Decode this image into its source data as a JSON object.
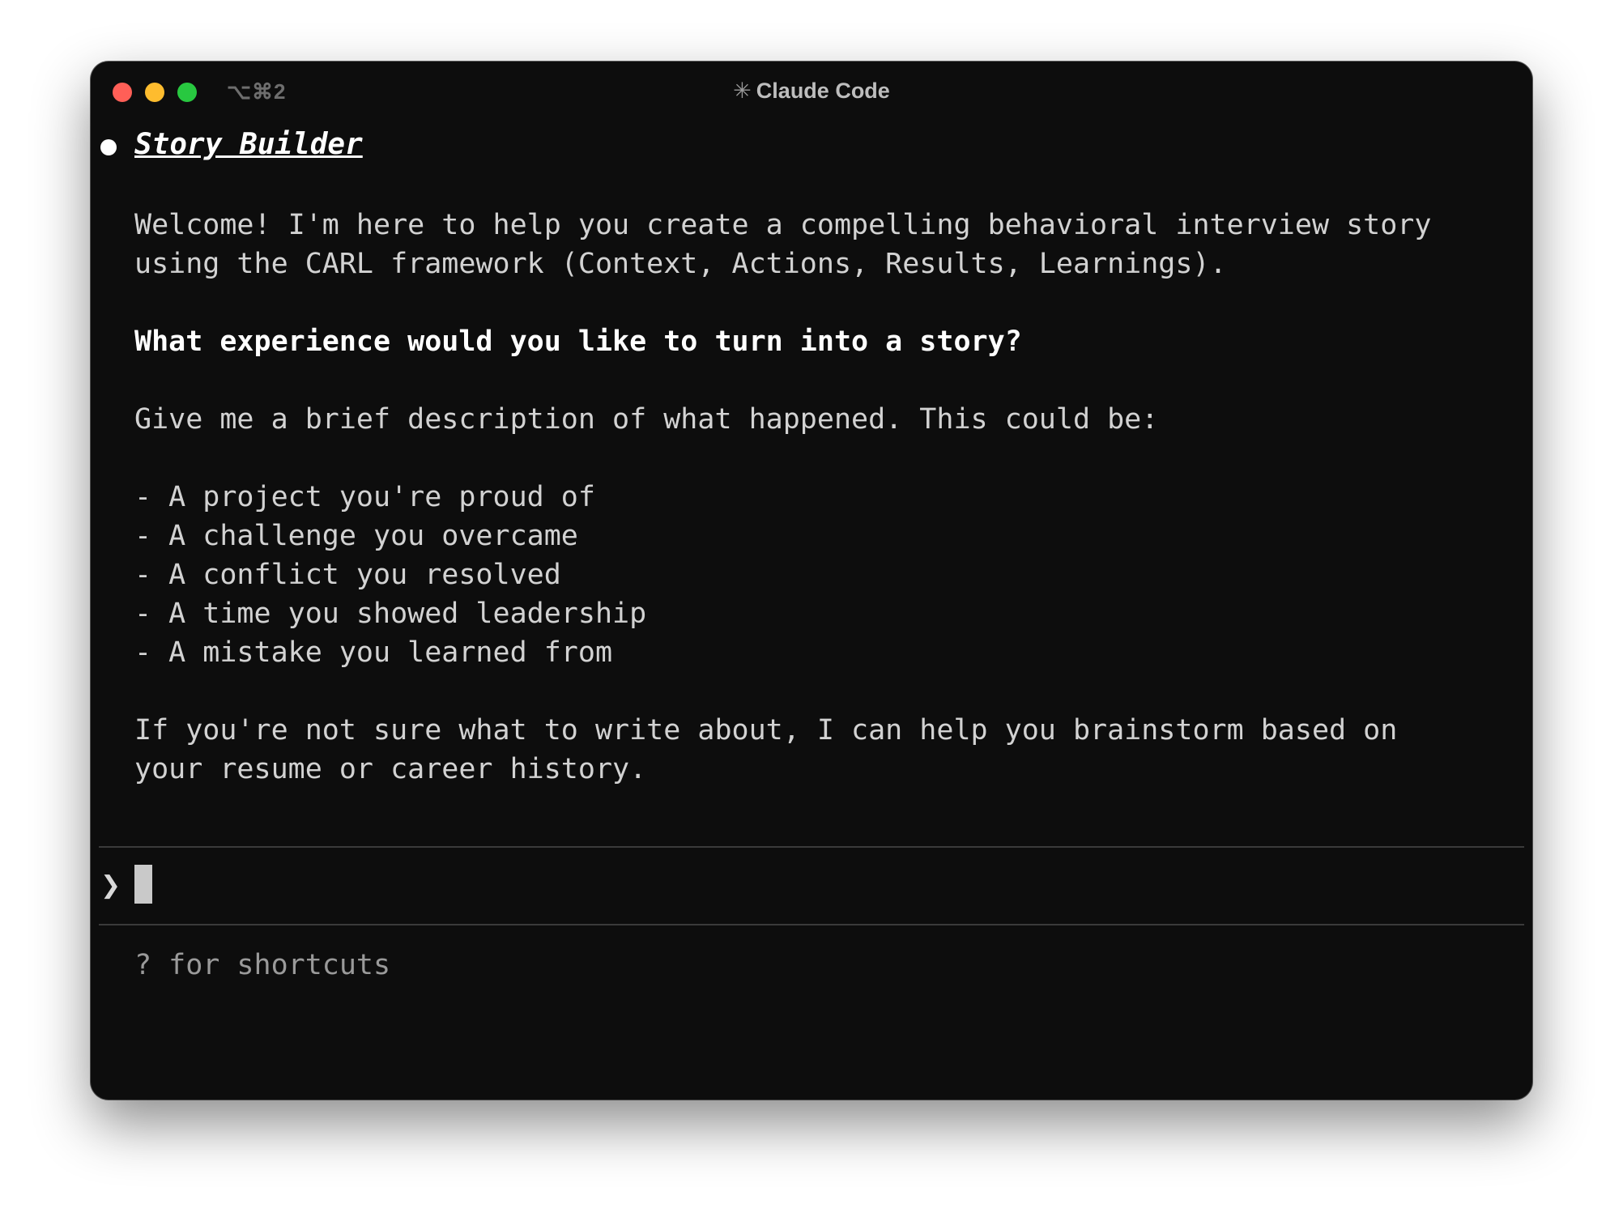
{
  "window": {
    "tab_shortcut": "⌥⌘2",
    "title_icon": "✳",
    "title": "Claude Code"
  },
  "message": {
    "heading": "Story Builder",
    "intro_line1": "Welcome! I'm here to help you create a compelling behavioral interview story",
    "intro_line2": "using the CARL framework (Context, Actions, Results, Learnings).",
    "question": "What experience would you like to turn into a story?",
    "prompt": "Give me a brief description of what happened. This could be:",
    "options": [
      "- A project you're proud of",
      "- A challenge you overcame",
      "- A conflict you resolved",
      "- A time you showed leadership",
      "- A mistake you learned from"
    ],
    "outro_line1": "If you're not sure what to write about, I can help you brainstorm based on",
    "outro_line2": "your resume or career history."
  },
  "input": {
    "prompt_symbol": "❯",
    "value": ""
  },
  "footer": {
    "hint": "? for shortcuts"
  }
}
